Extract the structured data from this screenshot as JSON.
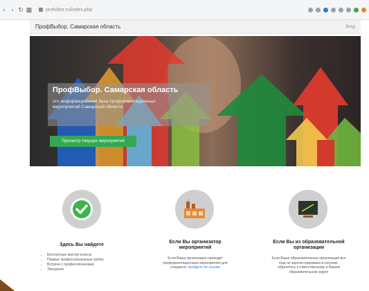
{
  "browser": {
    "url": "profvibor.ru/index.php"
  },
  "header": {
    "title": "ПрофВыбор. Самарская область",
    "login": "Вход"
  },
  "hero": {
    "title": "ПрофВыбор. Самарская область",
    "description": "это информационная база профориентационных мероприятий Самарской области",
    "button": "Просмотр текущих мероприятий"
  },
  "features": [
    {
      "title": "Здесь Вы найдете",
      "items": [
        "Бесплатные мастер-классы",
        "Первые профессиональные пробы",
        "Встречи с профессионалами",
        "Экскурсии"
      ]
    },
    {
      "title": "Если Вы организатор мероприятий",
      "text": "Если Ваша организация проводит профориентационные мероприятия для учащихся,",
      "link": "пройдите по ссылке"
    },
    {
      "title": "Если Вы из образовательной организации",
      "text": "Если Ваша образовательная организация все еще не зарегистрирована в системе, обратитесь к ответственному в Вашем образовательном округе"
    }
  ]
}
